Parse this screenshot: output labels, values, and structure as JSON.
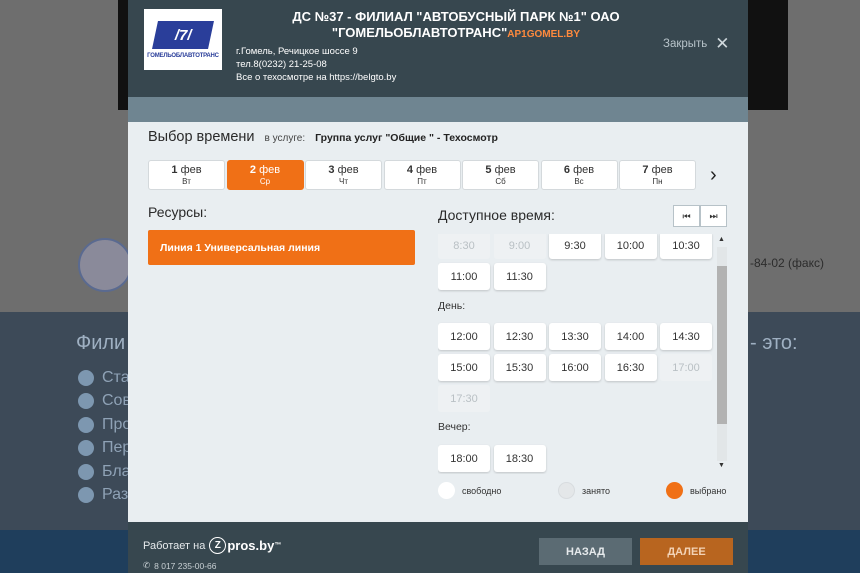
{
  "background": {
    "heading_fragment_left": "Фили",
    "heading_fragment_right": "- это:",
    "list_fragments": [
      "Ста",
      "Сов",
      "Про",
      "Пер",
      "Бла",
      "Раз"
    ],
    "fax_text": "-84-02 (факс)"
  },
  "header": {
    "logo_caption": "ГОМЕЛЬОБЛАВТОТРАНС",
    "title_line1": "ДС №37 - ФИЛИАЛ \"АВТОБУСНЫЙ ПАРК №1\" ОАО",
    "title_line2": "\"ГОМЕЛЬОБЛАВТОТРАНС\"",
    "title_link": "AP1GOMEL.BY",
    "address": "г.Гомель, Речицкое шоссе 9",
    "phone": "тел.8(0232) 21-25-08",
    "info_link": "Все о техосмотре на https://belgto.by",
    "close_label": "Закрыть",
    "close_icon": "close-icon"
  },
  "selection": {
    "title": "Выбор времени",
    "service_prefix": "в услуге:",
    "service_name": "Группа услуг \"Общие \" - Техосмотр"
  },
  "days": [
    {
      "num": "1",
      "month": "фев",
      "weekday": "Вт",
      "active": false
    },
    {
      "num": "2",
      "month": "фев",
      "weekday": "Ср",
      "active": true
    },
    {
      "num": "3",
      "month": "фев",
      "weekday": "Чт",
      "active": false
    },
    {
      "num": "4",
      "month": "фев",
      "weekday": "Пт",
      "active": false
    },
    {
      "num": "5",
      "month": "фев",
      "weekday": "Сб",
      "active": false
    },
    {
      "num": "6",
      "month": "фев",
      "weekday": "Вс",
      "active": false
    },
    {
      "num": "7",
      "month": "фев",
      "weekday": "Пн",
      "active": false
    }
  ],
  "resources": {
    "title": "Ресурсы:",
    "items": [
      "Линия 1 Универсальная линия"
    ]
  },
  "time": {
    "title": "Доступное время:",
    "morning_slots": [
      {
        "t": "8:30",
        "taken": true
      },
      {
        "t": "9:00",
        "taken": true
      },
      {
        "t": "9:30",
        "taken": false
      },
      {
        "t": "10:00",
        "taken": false
      },
      {
        "t": "10:30",
        "taken": false
      },
      {
        "t": "11:00",
        "taken": false
      },
      {
        "t": "11:30",
        "taken": false
      }
    ],
    "day_label": "День:",
    "day_slots": [
      {
        "t": "12:00",
        "taken": false
      },
      {
        "t": "12:30",
        "taken": false
      },
      {
        "t": "13:30",
        "taken": false
      },
      {
        "t": "14:00",
        "taken": false
      },
      {
        "t": "14:30",
        "taken": false
      },
      {
        "t": "15:00",
        "taken": false
      },
      {
        "t": "15:30",
        "taken": false
      },
      {
        "t": "16:00",
        "taken": false
      },
      {
        "t": "16:30",
        "taken": false
      },
      {
        "t": "17:00",
        "taken": true
      },
      {
        "t": "17:30",
        "taken": true
      }
    ],
    "evening_label": "Вечер:",
    "evening_slots": [
      {
        "t": "18:00",
        "taken": false
      },
      {
        "t": "18:30",
        "taken": false
      }
    ]
  },
  "legend": {
    "free": "свободно",
    "taken": "занято",
    "selected": "выбрано",
    "colors": {
      "free": "#ffffff",
      "taken": "#e4e7e9",
      "selected": "#f07016"
    }
  },
  "footer": {
    "powered_by": "Работает на",
    "brand_letter": "Z",
    "brand_rest": "pros.by",
    "brand_tm": "™",
    "phone": "8 017 235-00-66",
    "back_label": "НАЗАД",
    "next_label": "ДАЛЕЕ"
  }
}
